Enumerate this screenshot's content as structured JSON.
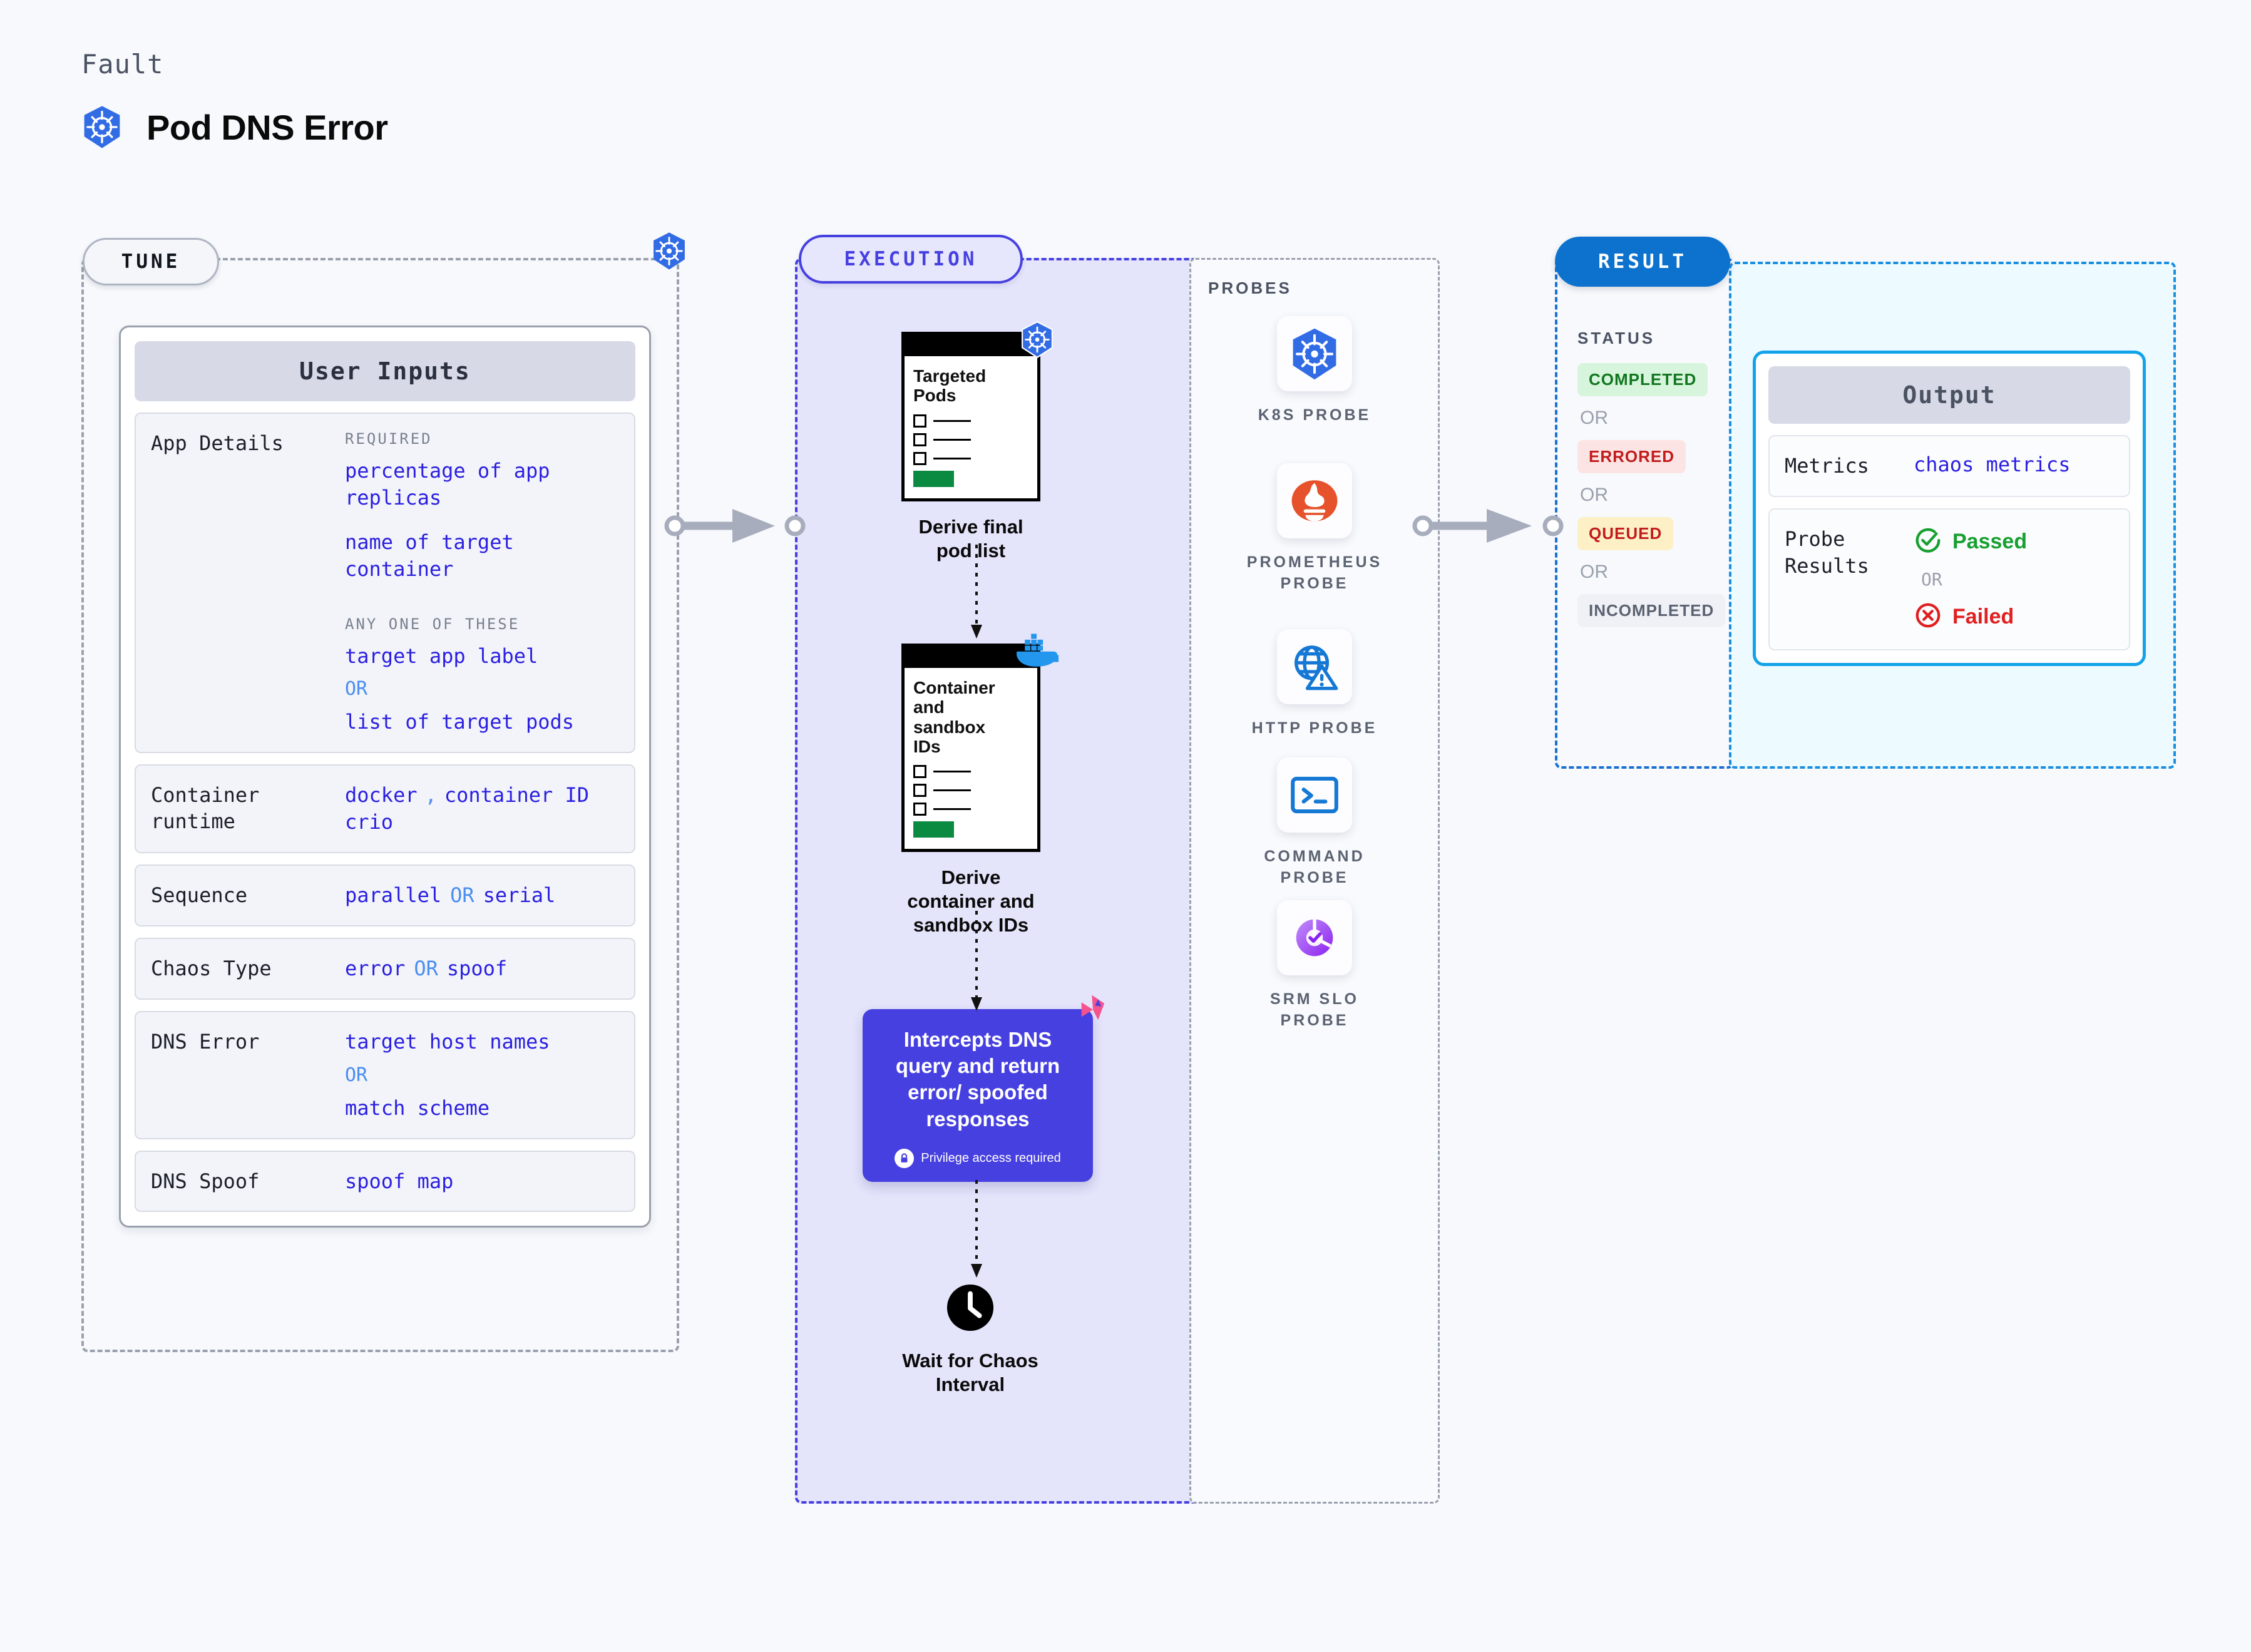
{
  "header": {
    "kicker": "Fault",
    "title": "Pod DNS Error",
    "icon": "kubernetes-icon"
  },
  "sections": {
    "tune_label": "TUNE",
    "execution_label": "EXECUTION",
    "result_label": "RESULT",
    "probes_label": "PROBES",
    "status_label": "STATUS"
  },
  "user_inputs": {
    "title": "User Inputs",
    "rows": [
      {
        "label": "App Details",
        "meta_required": "REQUIRED",
        "required_values": [
          "percentage of app\nreplicas",
          "name of target\ncontainer"
        ],
        "meta_anyone": "ANY ONE OF THESE",
        "any_values": [
          "target app label",
          "list of target pods"
        ],
        "or": "OR"
      },
      {
        "label": "Container\nruntime",
        "values": [
          "docker",
          "container ID",
          "crio"
        ],
        "separator": ","
      },
      {
        "label": "Sequence",
        "value_a": "parallel",
        "or": "OR",
        "value_b": "serial"
      },
      {
        "label": "Chaos Type",
        "value_a": "error",
        "or": "OR",
        "value_b": "spoof"
      },
      {
        "label": "DNS Error",
        "value_a": "target host names",
        "or": "OR",
        "value_b": "match scheme"
      },
      {
        "label": "DNS Spoof",
        "value_a": "spoof map"
      }
    ]
  },
  "execution": {
    "nodes": [
      {
        "card_title": "Targeted\nPods",
        "caption": "Derive final pod list",
        "badge": "kubernetes-icon"
      },
      {
        "card_title": "Container\nand\nsandbox\nIDs",
        "caption": "Derive container and\nsandbox IDs",
        "badge": "docker-icon"
      }
    ],
    "chaos": {
      "text": "Intercepts DNS query and return error/ spoofed responses",
      "privilege_note": "Privilege access required",
      "badge": "litmus-icon"
    },
    "wait": {
      "caption": "Wait for Chaos\nInterval",
      "icon": "clock-icon"
    }
  },
  "probes": [
    {
      "label": "K8S PROBE",
      "icon": "kubernetes-icon"
    },
    {
      "label": "PROMETHEUS\nPROBE",
      "icon": "prometheus-icon"
    },
    {
      "label": "HTTP PROBE",
      "icon": "globe-warning-icon"
    },
    {
      "label": "COMMAND\nPROBE",
      "icon": "terminal-icon"
    },
    {
      "label": "SRM SLO\nPROBE",
      "icon": "srm-slo-icon"
    }
  ],
  "result": {
    "statuses": [
      {
        "label": "COMPLETED",
        "style": "green"
      },
      {
        "label": "ERRORED",
        "style": "red"
      },
      {
        "label": "QUEUED",
        "style": "amber"
      },
      {
        "label": "INCOMPLETED",
        "style": "grey"
      }
    ],
    "or": "OR"
  },
  "output": {
    "title": "Output",
    "metrics_label": "Metrics",
    "metrics_value": "chaos metrics",
    "probe_results_label": "Probe\nResults",
    "passed": "Passed",
    "failed": "Failed",
    "or": "OR"
  },
  "colors": {
    "page_bg": "#f7f9fc",
    "tune_border": "#9aa0ad",
    "exec_accent": "#4740e0",
    "exec_bg": "#e4e4fb",
    "result_accent": "#1a6fd4",
    "output_accent": "#12a3e8",
    "output_bg": "#edfaff",
    "mono_value": "#2b1fe0",
    "or_blue": "#4a8ef0",
    "k8s_blue": "#326ce5",
    "docker_blue": "#2396ed",
    "prometheus_orange": "#e6522c",
    "green": "#17a030",
    "red": "#e02020"
  }
}
